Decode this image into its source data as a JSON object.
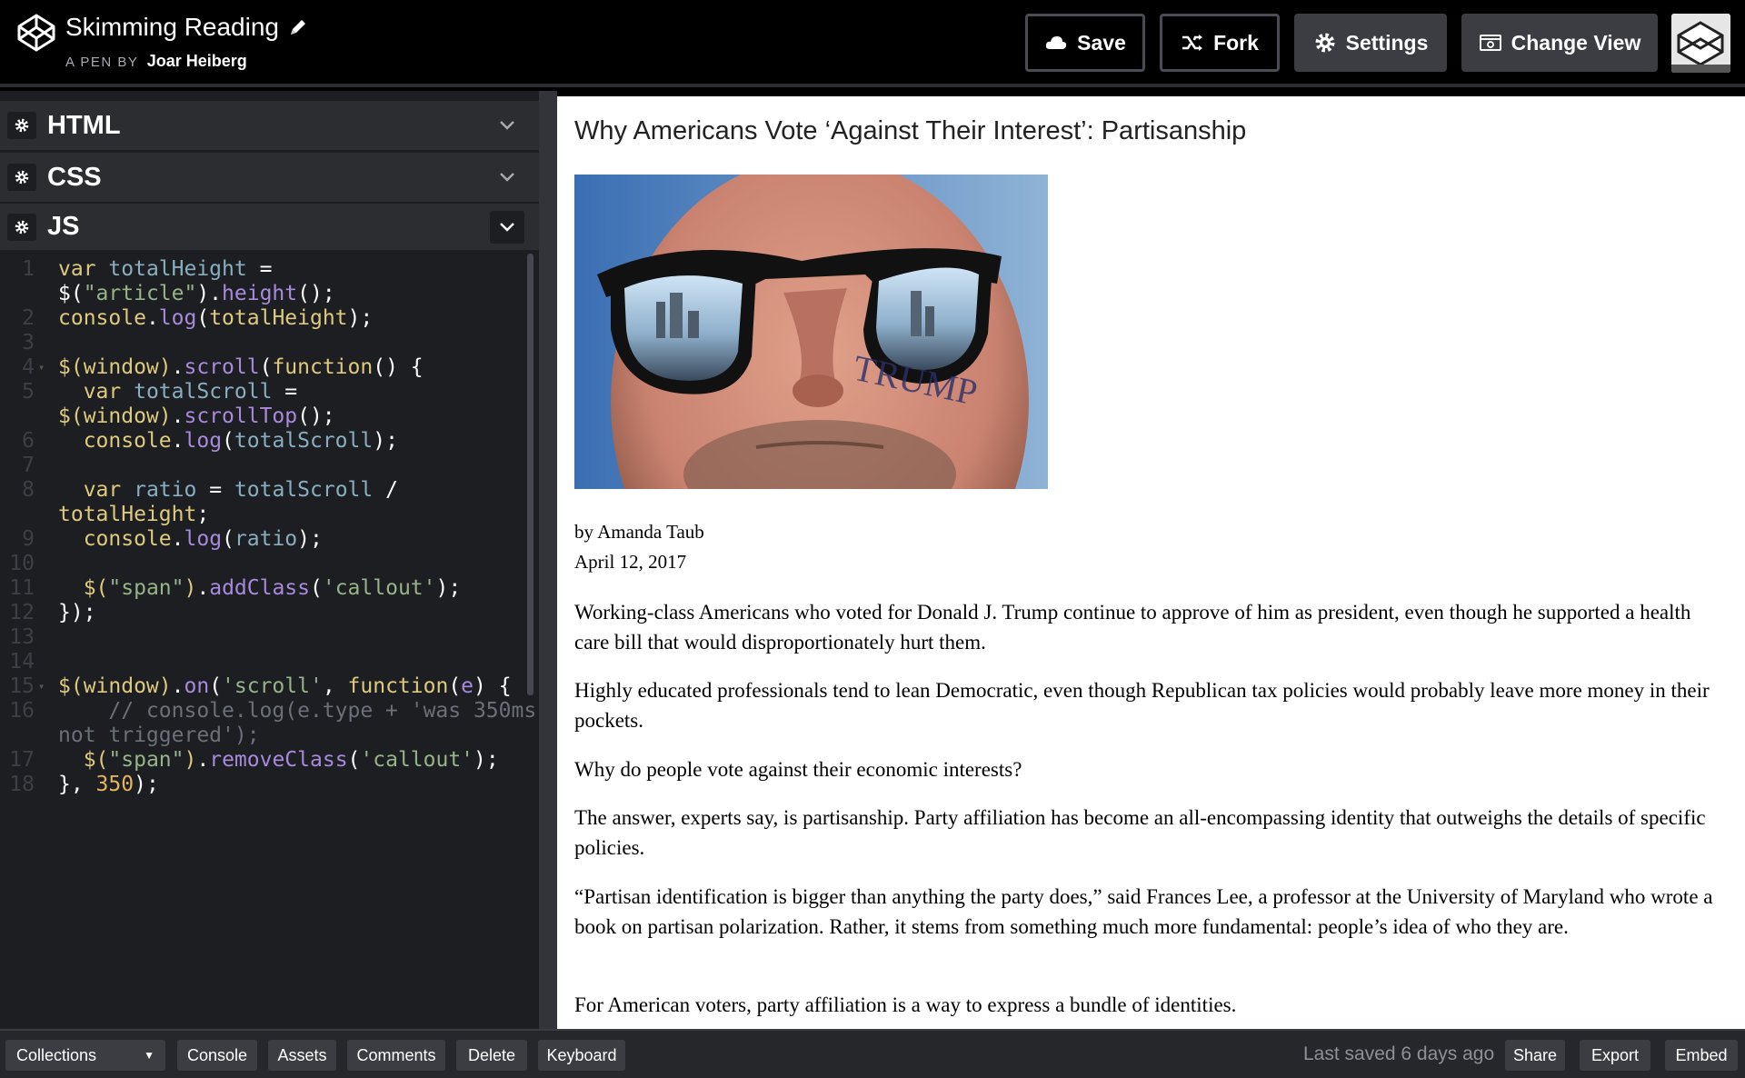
{
  "header": {
    "pen_title": "Skimming Reading",
    "pen_by_prefix": "A PEN BY",
    "author": "Joar Heiberg",
    "buttons": {
      "save": "Save",
      "fork": "Fork",
      "settings": "Settings",
      "change_view": "Change View"
    }
  },
  "editors": {
    "html_label": "HTML",
    "css_label": "CSS",
    "js_label": "JS"
  },
  "code": {
    "line_numbers": [
      "1",
      "2",
      "3",
      "4",
      "5",
      "6",
      "7",
      "8",
      "9",
      "10",
      "11",
      "12",
      "13",
      "14",
      "15",
      "16",
      "17",
      "18"
    ]
  },
  "article": {
    "title": "Why Americans Vote ‘Against Their Interest’: Partisanship",
    "photo_text": "TRUMP",
    "author": "by Amanda Taub",
    "date": "April 12, 2017",
    "paragraphs": [
      "Working-class Americans who voted for Donald J. Trump continue to approve of him as president, even though he supported a health care bill that would disproportionately hurt them.",
      "Highly educated professionals tend to lean Democratic, even though Republican tax policies would probably leave more money in their pockets.",
      "Why do people vote against their economic interests?",
      "The answer, experts say, is partisanship. Party affiliation has become an all-encompassing identity that outweighs the details of specific policies.",
      "“Partisan identification is bigger than anything the party does,” said Frances Lee, a professor at the University of Maryland who wrote a book on partisan polarization. Rather, it stems from something much more fundamental: people’s idea of who they are.",
      "For American voters, party affiliation is a way to express a bundle of identities."
    ]
  },
  "footer": {
    "collections": "Collections",
    "console": "Console",
    "assets": "Assets",
    "comments": "Comments",
    "delete": "Delete",
    "keyboard": "Keyboard",
    "last_saved": "Last saved 6 days ago",
    "share": "Share",
    "export": "Export",
    "embed": "Embed"
  }
}
